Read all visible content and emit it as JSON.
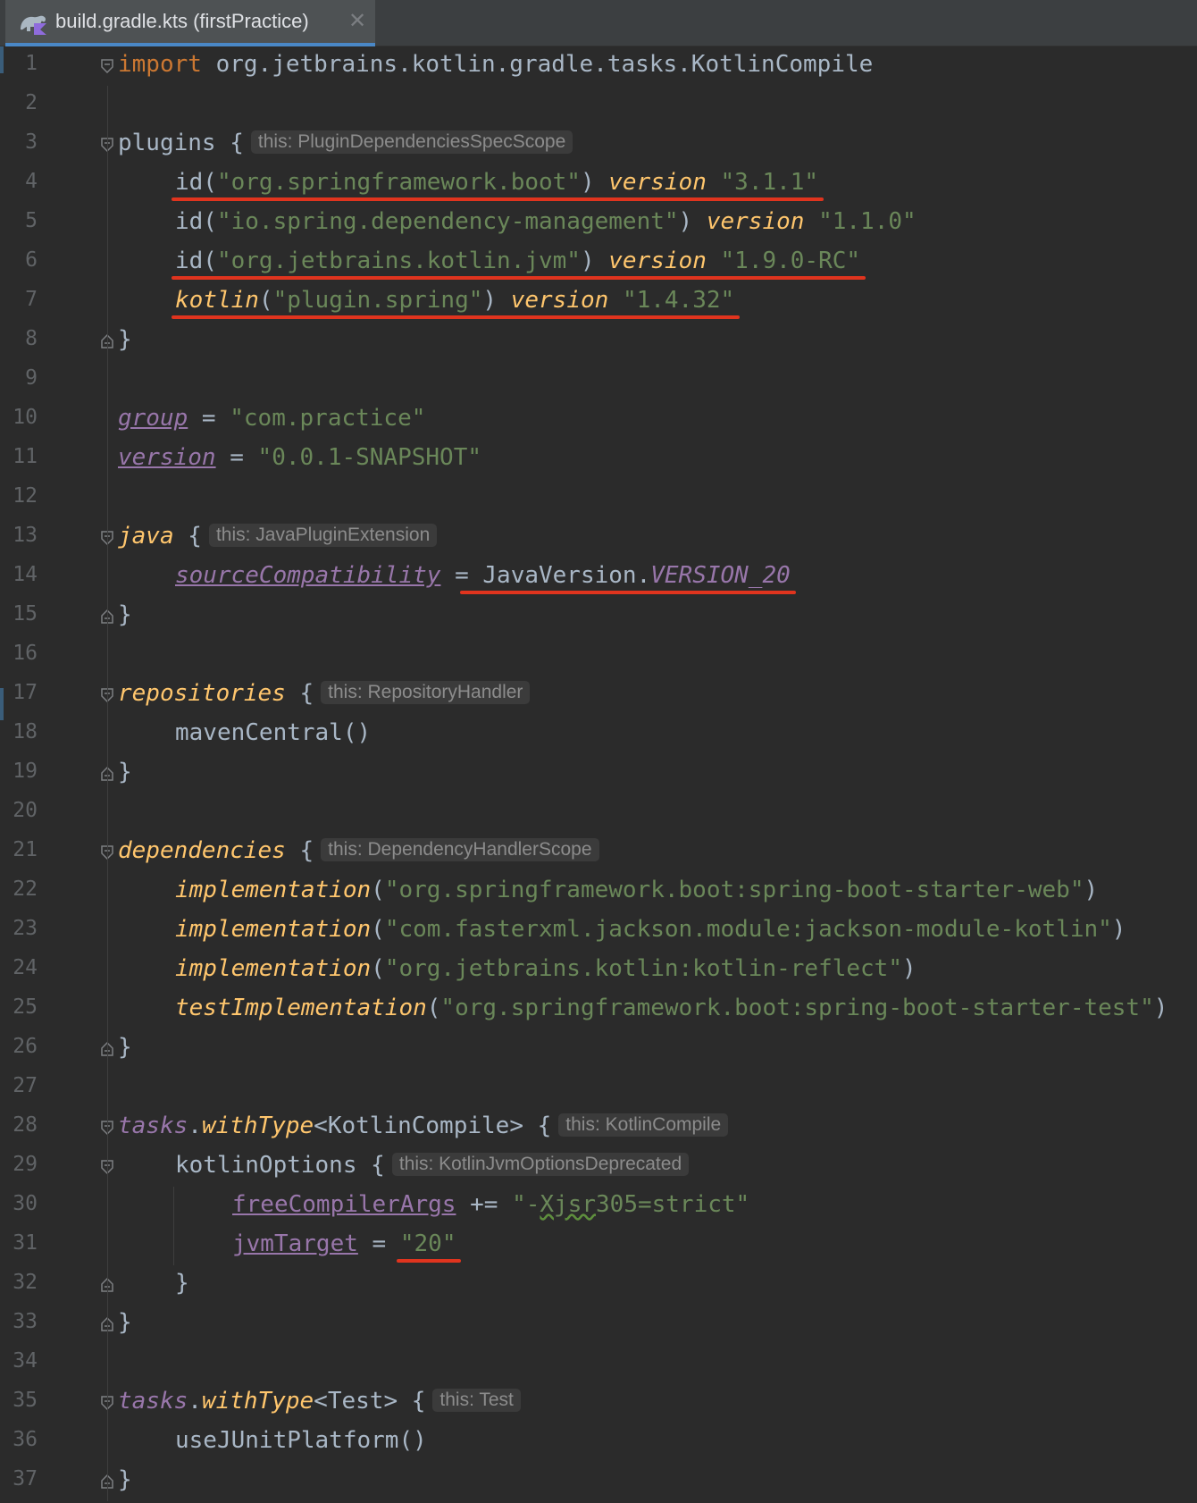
{
  "tab": {
    "title": "build.gradle.kts (firstPractice)",
    "close": "✕",
    "icon": "gradle-kotlin-file-icon"
  },
  "lines": [
    {
      "n": "1",
      "fold": "start",
      "indent": 0,
      "tokens": [
        [
          "kw",
          "import"
        ],
        [
          "p",
          " org.jetbrains.kotlin.gradle.tasks.KotlinCompile"
        ]
      ]
    },
    {
      "n": "2",
      "indent": 0,
      "tokens": []
    },
    {
      "n": "3",
      "fold": "start",
      "indent": 0,
      "tokens": [
        [
          "p",
          "plugins {"
        ]
      ],
      "hint": "this: PluginDependenciesSpecScope"
    },
    {
      "n": "4",
      "indent": 1,
      "tokens": [
        [
          "p",
          "id("
        ],
        [
          "str",
          "\"org.springframework.boot\""
        ],
        [
          "p",
          ") "
        ],
        [
          "fn",
          "version"
        ],
        [
          "p",
          " "
        ],
        [
          "str",
          "\"3.1.1\""
        ]
      ]
    },
    {
      "n": "5",
      "indent": 1,
      "tokens": [
        [
          "p",
          "id("
        ],
        [
          "str",
          "\"io.spring.dependency-management\""
        ],
        [
          "p",
          ") "
        ],
        [
          "fn",
          "version"
        ],
        [
          "p",
          " "
        ],
        [
          "str",
          "\"1.1.0\""
        ]
      ]
    },
    {
      "n": "6",
      "indent": 1,
      "tokens": [
        [
          "p",
          "id("
        ],
        [
          "str",
          "\"org.jetbrains.kotlin.jvm\""
        ],
        [
          "p",
          ") "
        ],
        [
          "fn",
          "version"
        ],
        [
          "p",
          " "
        ],
        [
          "str",
          "\"1.9.0-RC\""
        ]
      ]
    },
    {
      "n": "7",
      "indent": 1,
      "tokens": [
        [
          "fn",
          "kotlin"
        ],
        [
          "p",
          "("
        ],
        [
          "str",
          "\"plugin.spring\""
        ],
        [
          "p",
          ") "
        ],
        [
          "fn",
          "version"
        ],
        [
          "p",
          " "
        ],
        [
          "str",
          "\"1.4.32\""
        ]
      ]
    },
    {
      "n": "8",
      "fold": "end",
      "indent": 0,
      "tokens": [
        [
          "p",
          "}"
        ]
      ]
    },
    {
      "n": "9",
      "indent": 0,
      "tokens": []
    },
    {
      "n": "10",
      "indent": 0,
      "tokens": [
        [
          "prop",
          "group"
        ],
        [
          "p",
          " = "
        ],
        [
          "str",
          "\"com.practice\""
        ]
      ]
    },
    {
      "n": "11",
      "indent": 0,
      "tokens": [
        [
          "prop",
          "version"
        ],
        [
          "p",
          " = "
        ],
        [
          "str",
          "\"0.0.1-SNAPSHOT\""
        ]
      ]
    },
    {
      "n": "12",
      "indent": 0,
      "tokens": []
    },
    {
      "n": "13",
      "fold": "start",
      "indent": 0,
      "tokens": [
        [
          "fn",
          "java"
        ],
        [
          "p",
          " {"
        ]
      ],
      "hint": "this: JavaPluginExtension"
    },
    {
      "n": "14",
      "indent": 1,
      "tokens": [
        [
          "prop",
          "sourceCompatibility"
        ],
        [
          "p",
          " = JavaVersion."
        ],
        [
          "ext",
          "VERSION_20"
        ]
      ]
    },
    {
      "n": "15",
      "fold": "end",
      "indent": 0,
      "tokens": [
        [
          "p",
          "}"
        ]
      ]
    },
    {
      "n": "16",
      "indent": 0,
      "tokens": []
    },
    {
      "n": "17",
      "fold": "start",
      "indent": 0,
      "tokens": [
        [
          "fn",
          "repositories"
        ],
        [
          "p",
          " {"
        ]
      ],
      "hint": "this: RepositoryHandler"
    },
    {
      "n": "18",
      "indent": 1,
      "tokens": [
        [
          "p",
          "mavenCentral()"
        ]
      ]
    },
    {
      "n": "19",
      "fold": "end",
      "indent": 0,
      "tokens": [
        [
          "p",
          "}"
        ]
      ]
    },
    {
      "n": "20",
      "indent": 0,
      "tokens": []
    },
    {
      "n": "21",
      "fold": "start",
      "indent": 0,
      "tokens": [
        [
          "fn",
          "dependencies"
        ],
        [
          "p",
          " {"
        ]
      ],
      "hint": "this: DependencyHandlerScope"
    },
    {
      "n": "22",
      "indent": 1,
      "tokens": [
        [
          "fn",
          "implementation"
        ],
        [
          "p",
          "("
        ],
        [
          "str",
          "\"org.springframework.boot:spring-boot-starter-web\""
        ],
        [
          "p",
          ")"
        ]
      ]
    },
    {
      "n": "23",
      "indent": 1,
      "tokens": [
        [
          "fn",
          "implementation"
        ],
        [
          "p",
          "("
        ],
        [
          "str",
          "\"com.fasterxml.jackson.module:jackson-module-kotlin\""
        ],
        [
          "p",
          ")"
        ]
      ]
    },
    {
      "n": "24",
      "indent": 1,
      "tokens": [
        [
          "fn",
          "implementation"
        ],
        [
          "p",
          "("
        ],
        [
          "str",
          "\"org.jetbrains.kotlin:kotlin-reflect\""
        ],
        [
          "p",
          ")"
        ]
      ]
    },
    {
      "n": "25",
      "indent": 1,
      "tokens": [
        [
          "fn",
          "testImplementation"
        ],
        [
          "p",
          "("
        ],
        [
          "str",
          "\"org.springframework.boot:spring-boot-starter-test\""
        ],
        [
          "p",
          ")"
        ]
      ]
    },
    {
      "n": "26",
      "fold": "end",
      "indent": 0,
      "tokens": [
        [
          "p",
          "}"
        ]
      ]
    },
    {
      "n": "27",
      "indent": 0,
      "tokens": []
    },
    {
      "n": "28",
      "fold": "start",
      "indent": 0,
      "tokens": [
        [
          "ext",
          "tasks"
        ],
        [
          "p",
          "."
        ],
        [
          "fn",
          "withType"
        ],
        [
          "p",
          "<KotlinCompile> {"
        ]
      ],
      "hint": "this: KotlinCompile"
    },
    {
      "n": "29",
      "fold": "start",
      "indent": 1,
      "tokens": [
        [
          "p",
          "kotlinOptions {"
        ]
      ],
      "hint": "this: KotlinJvmOptionsDeprecated"
    },
    {
      "n": "30",
      "indent": 2,
      "tokens": [
        [
          "propu",
          "freeCompilerArgs"
        ],
        [
          "p",
          " += "
        ],
        [
          "str",
          "\"-"
        ],
        [
          "strw",
          "Xjsr"
        ],
        [
          "str",
          "305=strict\""
        ]
      ]
    },
    {
      "n": "31",
      "indent": 2,
      "tokens": [
        [
          "propu",
          "jvmTarget"
        ],
        [
          "p",
          " = "
        ],
        [
          "str",
          "\"20\""
        ]
      ]
    },
    {
      "n": "32",
      "fold": "end",
      "indent": 1,
      "tokens": [
        [
          "p",
          "}"
        ]
      ]
    },
    {
      "n": "33",
      "fold": "end",
      "indent": 0,
      "tokens": [
        [
          "p",
          "}"
        ]
      ]
    },
    {
      "n": "34",
      "indent": 0,
      "tokens": []
    },
    {
      "n": "35",
      "fold": "start",
      "indent": 0,
      "tokens": [
        [
          "ext",
          "tasks"
        ],
        [
          "p",
          "."
        ],
        [
          "fn",
          "withType"
        ],
        [
          "p",
          "<Test> {"
        ]
      ],
      "hint": "this: Test"
    },
    {
      "n": "36",
      "indent": 1,
      "tokens": [
        [
          "p",
          "useJUnitPlatform()"
        ]
      ]
    },
    {
      "n": "37",
      "fold": "end",
      "indent": 0,
      "tokens": [
        [
          "p",
          "}"
        ]
      ]
    }
  ],
  "annotations": [
    {
      "line": "4",
      "color": "#e0341e"
    },
    {
      "line": "6",
      "color": "#e0341e"
    },
    {
      "line": "7",
      "color": "#e0341e"
    },
    {
      "line": "14",
      "color": "#e0341e"
    },
    {
      "line": "31",
      "color": "#e0341e"
    }
  ]
}
